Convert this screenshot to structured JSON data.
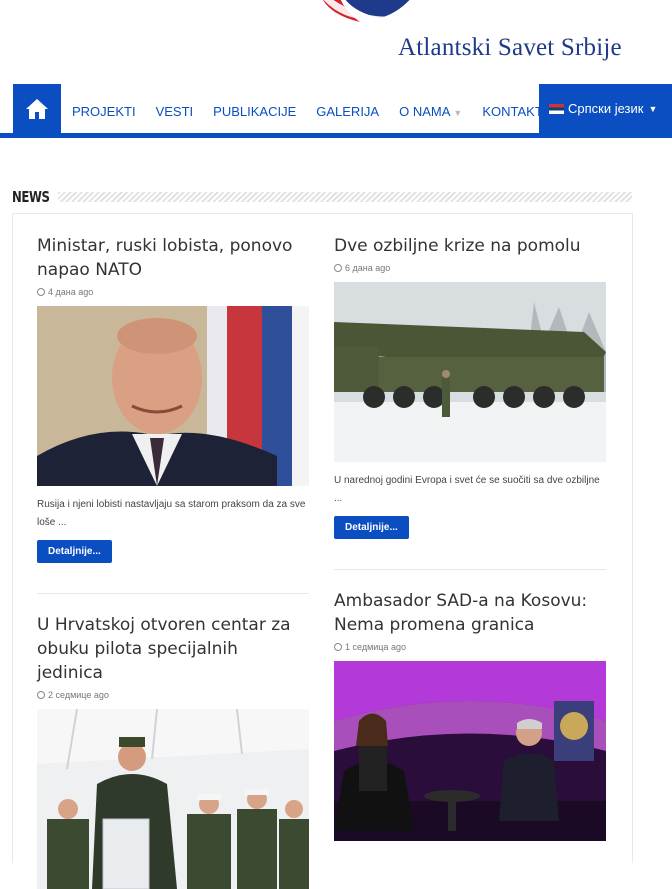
{
  "site": {
    "name": "Atlantski Savet Srbije"
  },
  "nav": {
    "items": [
      {
        "label": "PROJEKTI",
        "has_dropdown": false
      },
      {
        "label": "VESTI",
        "has_dropdown": false
      },
      {
        "label": "PUBLIKACIJE",
        "has_dropdown": false
      },
      {
        "label": "GALERIJA",
        "has_dropdown": false
      },
      {
        "label": "O NAMA",
        "has_dropdown": true
      },
      {
        "label": "KONTAKT",
        "has_dropdown": false
      }
    ],
    "language": "Српски језик",
    "home_icon": "home-icon",
    "accent_color": "#0a4ec1"
  },
  "section": {
    "title": "NEWS"
  },
  "posts": [
    {
      "title": "Ministar, ruski lobista, ponovo napao NATO",
      "date": "4 дана ago",
      "excerpt": "Rusija i njeni lobisti nastavljaju sa starom praksom da za sve loše ...",
      "button": "Detaljnije..."
    },
    {
      "title": "Dve ozbiljne krize na pomolu",
      "date": "6 дана ago",
      "excerpt": "U narednoj godini Evropa i svet će se suočiti sa dve ozbiljne ...",
      "button": "Detaljnije..."
    },
    {
      "title": "U Hrvatskoj otvoren centar za obuku pilota specijalnih jedinica",
      "date": "2 седмице ago"
    },
    {
      "title": "Ambasador SAD-a na Kosovu: Nema promena granica",
      "date": "1 седмица ago"
    }
  ]
}
